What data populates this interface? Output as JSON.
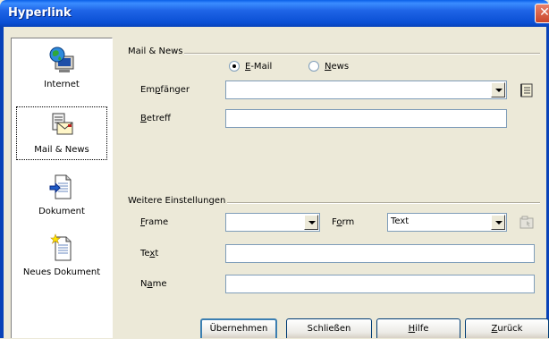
{
  "window": {
    "title": "Hyperlink",
    "close_glyph": "✕"
  },
  "nav": {
    "items": [
      {
        "label": "Internet",
        "icon": "globe-computer-icon",
        "selected": false
      },
      {
        "label": "Mail & News",
        "icon": "mail-news-icon",
        "selected": true
      },
      {
        "label": "Dokument",
        "icon": "document-icon",
        "selected": false
      },
      {
        "label": "Neues Dokument",
        "icon": "new-document-icon",
        "selected": false
      }
    ]
  },
  "mail_news": {
    "group_title": "Mail & News",
    "radio_email": {
      "label": "E-Mail",
      "accel": "E",
      "rest": "-Mail",
      "checked": true
    },
    "radio_news": {
      "label": "News",
      "accel": "N",
      "rest": "ews",
      "checked": false
    },
    "recipient": {
      "label": "Empfänger",
      "accel_pre": "Em",
      "accel": "p",
      "rest": "fänger",
      "value": ""
    },
    "subject": {
      "label": "Betreff",
      "accel": "B",
      "rest": "etreff",
      "value": ""
    }
  },
  "further": {
    "group_title": "Weitere Einstellungen",
    "frame": {
      "label": "Frame",
      "accel": "F",
      "rest": "rame",
      "value": ""
    },
    "form": {
      "label": "Form",
      "accel_pre": "F",
      "accel": "o",
      "rest": "rm",
      "value": "Text"
    },
    "text": {
      "label": "Text",
      "accel_pre": "Te",
      "accel": "x",
      "rest": "t",
      "value": ""
    },
    "name": {
      "label": "Name",
      "accel_pre": "N",
      "accel": "a",
      "rest": "me",
      "value": ""
    }
  },
  "buttons": {
    "apply": "Übernehmen",
    "close": "Schließen",
    "help": {
      "label": "Hilfe",
      "accel": "H",
      "rest": "ilfe"
    },
    "back": {
      "label": "Zurück",
      "accel": "Z",
      "rest": "urück"
    }
  },
  "colors": {
    "titlebar": "#0A4FD4",
    "dialog_bg": "#ECE9D8",
    "field_border": "#7F9DB9"
  }
}
